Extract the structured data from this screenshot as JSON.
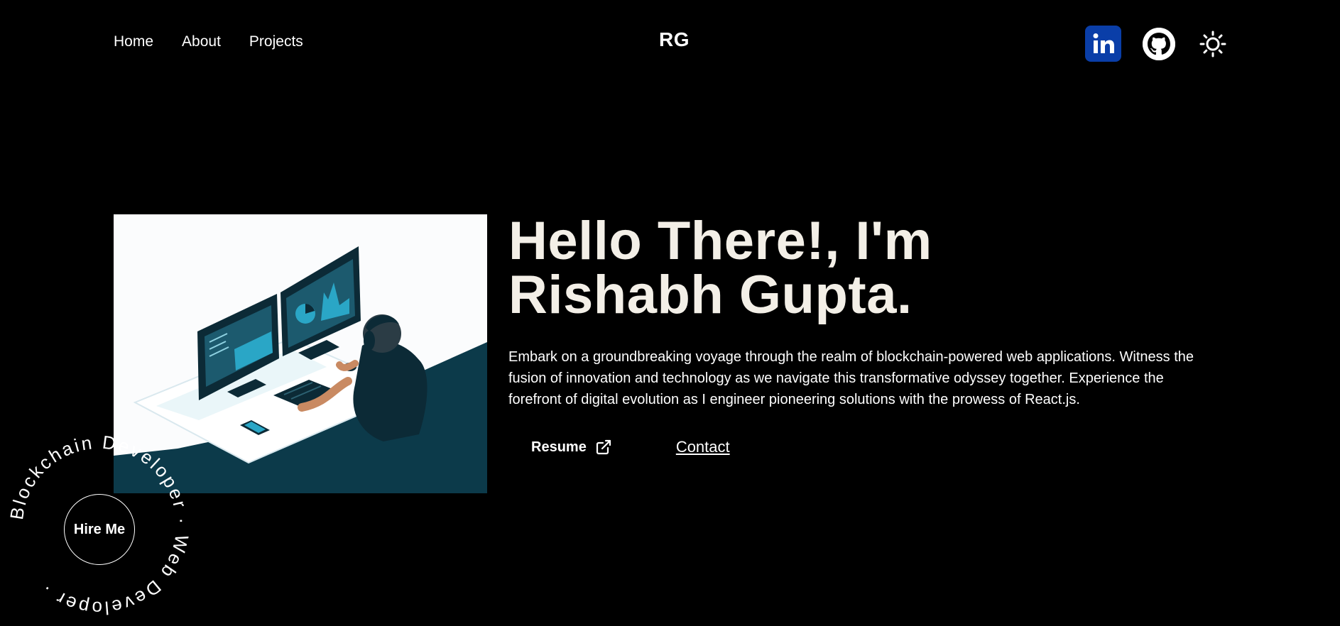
{
  "header": {
    "nav": [
      {
        "label": "Home"
      },
      {
        "label": "About"
      },
      {
        "label": "Projects"
      }
    ],
    "logo": "RG",
    "social": {
      "linkedin_icon": "linkedin-icon",
      "github_icon": "github-icon",
      "theme_icon": "sun-icon"
    }
  },
  "hero": {
    "title_line1": "Hello There!, I'm",
    "title_line2": "Rishabh Gupta.",
    "description": "Embark on a groundbreaking voyage through the realm of blockchain-powered web applications. Witness the fusion of innovation and technology as we navigate this transformative odyssey together. Experience the forefront of digital evolution as I engineer pioneering solutions with the prowess of React.js.",
    "resume_label": "Resume",
    "contact_label": "Contact"
  },
  "badge": {
    "circular_text": "Blockchain Developer · Web Developer · ",
    "button_label": "Hire Me"
  },
  "colors": {
    "background": "#000000",
    "heading": "#f3efe7",
    "linkedin": "#0a3ea8",
    "illustration_dark": "#0c3a4a",
    "illustration_accent": "#2aa6c6"
  }
}
